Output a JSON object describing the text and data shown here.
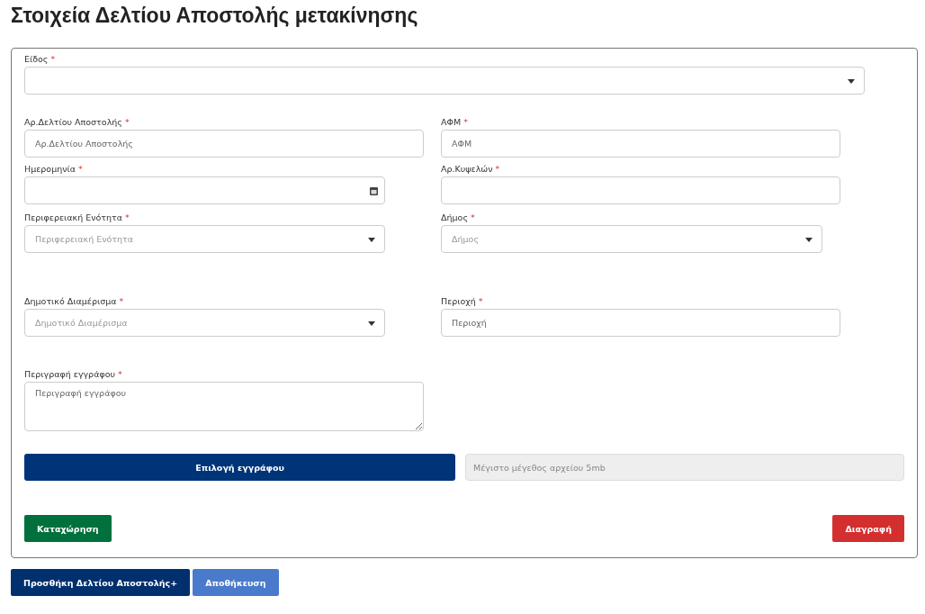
{
  "title": "Στοιχεία Δελτίου Αποστολής μετακίνησης",
  "type_field": {
    "label": "Είδος",
    "mark": "*",
    "kind": "select"
  },
  "rows": [
    [
      {
        "label": "Αρ.Δελτίου Αποστολής",
        "mark": "*",
        "kind": "text",
        "placeholder": "Αρ.Δελτίου Αποστολής"
      },
      {
        "label": "ΑΦΜ",
        "mark": "*",
        "kind": "text",
        "placeholder": "ΑΦΜ"
      }
    ],
    [
      {
        "label": "Ημερομηνία",
        "mark": "*",
        "kind": "date"
      },
      {
        "label": "Αρ.Κυψελών",
        "mark": "*",
        "kind": "text"
      }
    ],
    [
      {
        "label": "Περιφερειακή Ενότητα",
        "mark": "*",
        "kind": "select",
        "placeholder": "Περιφερειακή Ενότητα"
      },
      {
        "label": "Δήμος",
        "mark": "*",
        "kind": "select",
        "placeholder": "Δήμος"
      }
    ],
    [
      {
        "label": "Δημοτικό Διαμέρισμα",
        "mark": "*",
        "kind": "select",
        "placeholder": "Δημοτικό Διαμέρισμα"
      },
      {
        "label": "Περιοχή",
        "mark": "*",
        "kind": "text",
        "placeholder": "Περιοχή"
      }
    ],
    [
      {
        "label": "Περιγραφή εγγράφου",
        "mark": "*",
        "kind": "textarea",
        "placeholder": "Περιγραφή εγγράφου"
      }
    ]
  ],
  "file": {
    "button": "Επιλογή εγγράφου",
    "placeholder": "Μέγιστο μέγεθος αρχείου 5mb"
  },
  "card_buttons": [
    {
      "label": "Καταχώρηση",
      "kind": "submit"
    },
    {
      "label": "Διαγραφή",
      "kind": "delete"
    }
  ],
  "page_buttons": [
    {
      "label": "Προσθήκη Δελτίου Αποστολής+",
      "kind": "primary"
    },
    {
      "label": "Αποθήκευση",
      "kind": "secondary"
    }
  ]
}
